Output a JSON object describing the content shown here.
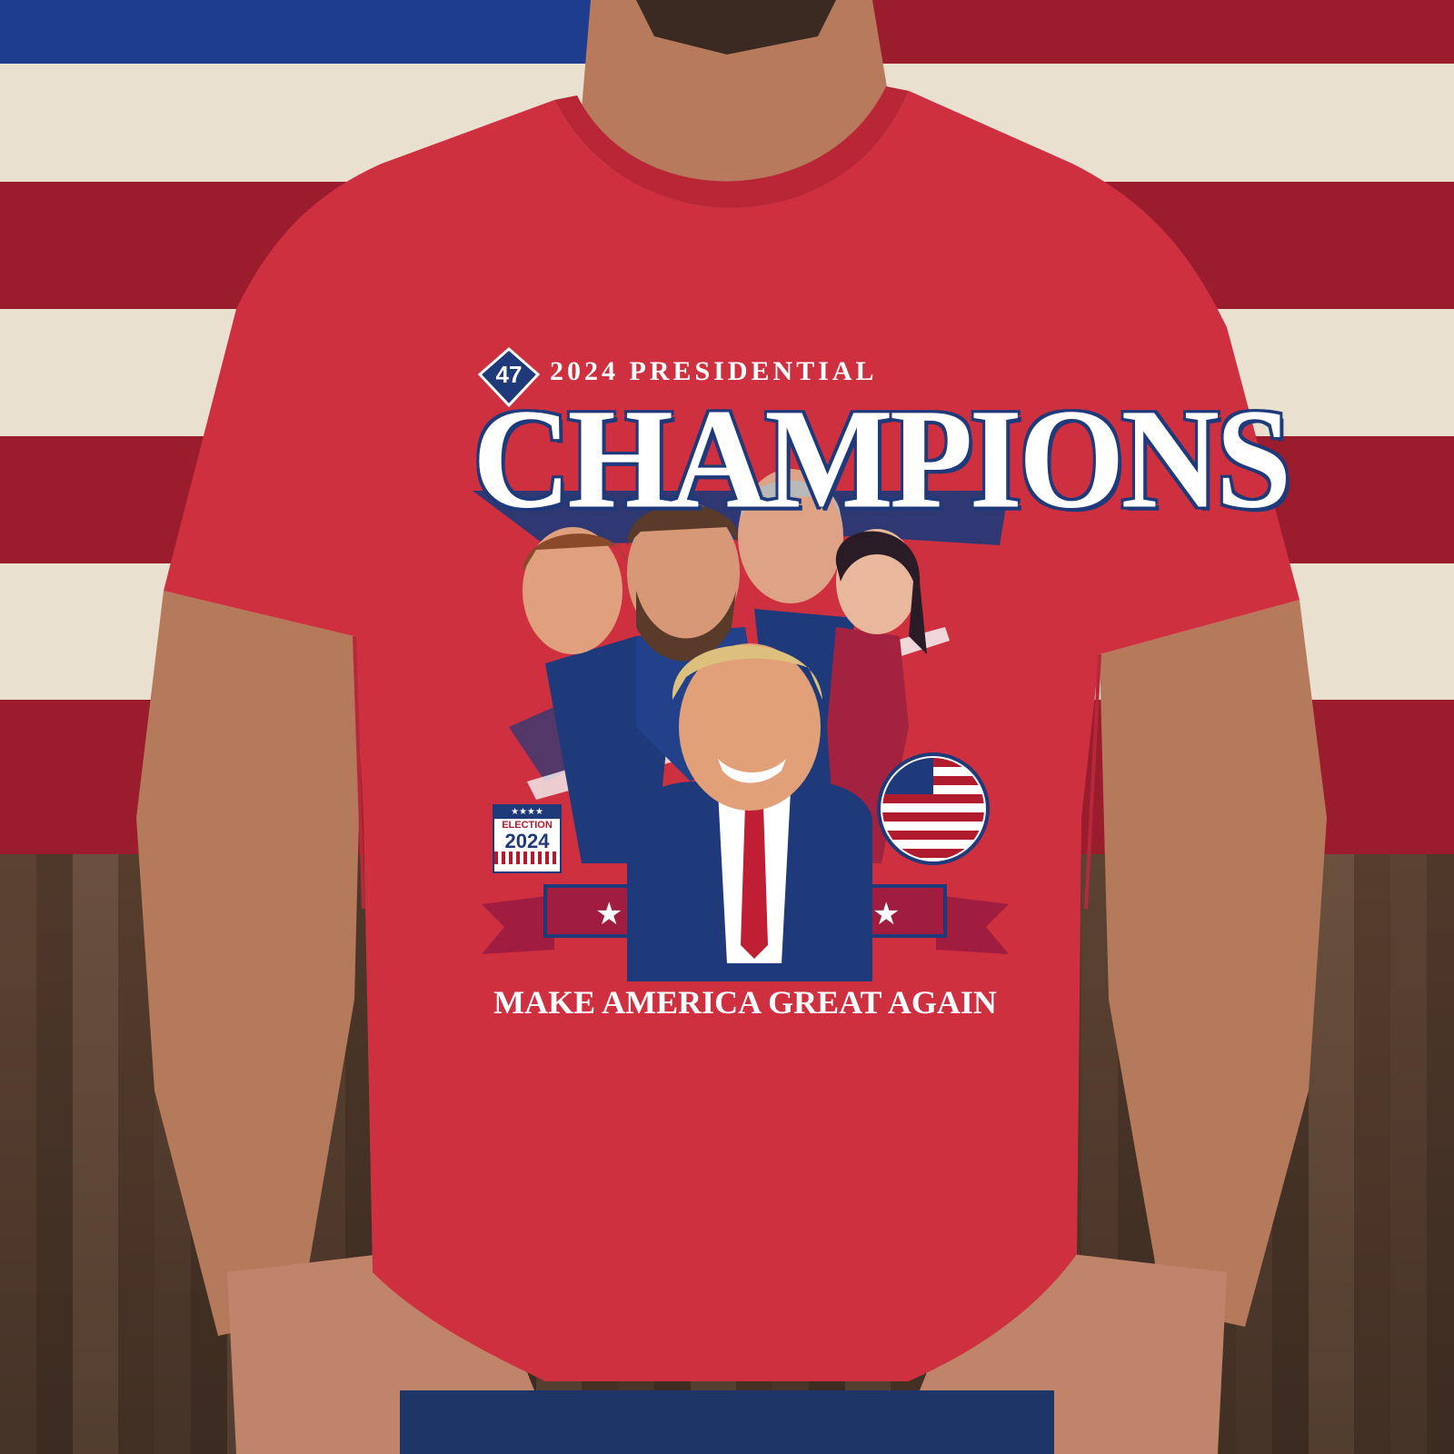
{
  "shirt_graphic": {
    "badge_number": "47",
    "headline_small": "2024 PRESIDENTIAL",
    "headline_large": "CHAMPIONS",
    "election_badge": {
      "stars": "★★★★",
      "label": "ELECTION",
      "year": "2024"
    },
    "slogan": "MAKE AMERICA GREAT AGAIN"
  },
  "colors": {
    "shirt": "#cf3040",
    "flag_red": "#9b1c2c",
    "flag_white": "#e9e0cf",
    "flag_blue": "#1f3d8f",
    "graphic_navy": "#1e3a7a"
  }
}
